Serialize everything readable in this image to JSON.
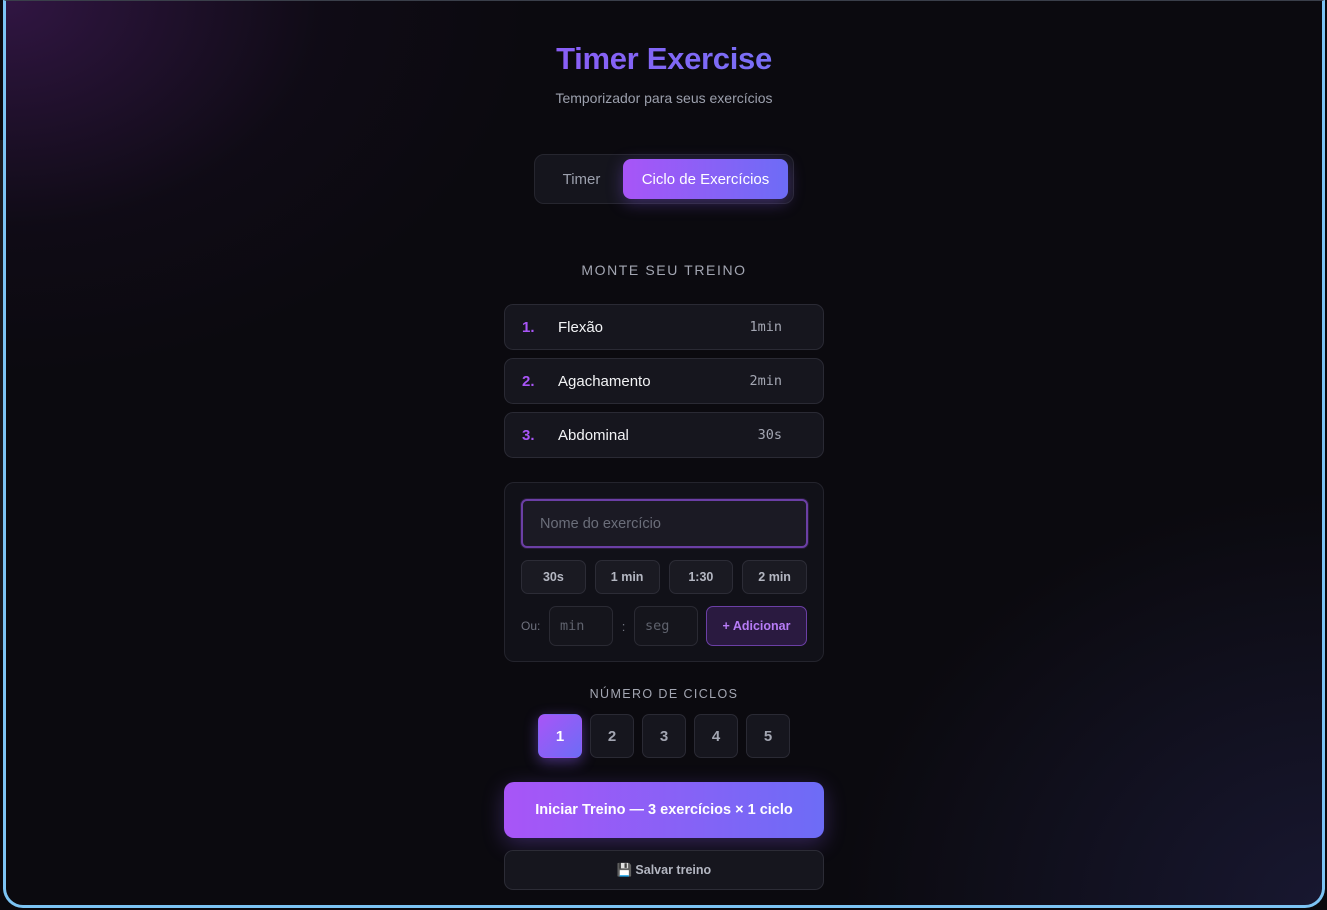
{
  "header": {
    "title": "Timer Exercise",
    "subtitle": "Temporizador para seus exercícios"
  },
  "tabs": [
    {
      "label": "Timer",
      "active": false
    },
    {
      "label": "Ciclo de Exercícios",
      "active": true
    }
  ],
  "workout": {
    "section_title": "MONTE SEU TREINO",
    "exercises": [
      {
        "num": "1.",
        "name": "Flexão",
        "duration": "1min"
      },
      {
        "num": "2.",
        "name": "Agachamento",
        "duration": "2min"
      },
      {
        "num": "3.",
        "name": "Abdominal",
        "duration": "30s"
      }
    ]
  },
  "add_form": {
    "name_placeholder": "Nome do exercício",
    "name_value": "",
    "presets": [
      "30s",
      "1 min",
      "1:30",
      "2 min"
    ],
    "or_label": "Ou:",
    "min_placeholder": "min",
    "sec_placeholder": "seg",
    "separator": ":",
    "add_label": "+ Adicionar"
  },
  "cycles": {
    "label": "NÚMERO DE CICLOS",
    "options": [
      "1",
      "2",
      "3",
      "4",
      "5"
    ],
    "selected": "1"
  },
  "actions": {
    "start_label": "Iniciar Treino — 3 exercícios × 1 ciclo",
    "save_icon": "💾",
    "save_label": "Salvar treino"
  },
  "colors": {
    "accent_start": "#a855f7",
    "accent_end": "#6d6cf6",
    "title_gradient_end": "#22c7e6",
    "background": "#0b0a0f",
    "frame_border": "#7cc4f4"
  }
}
